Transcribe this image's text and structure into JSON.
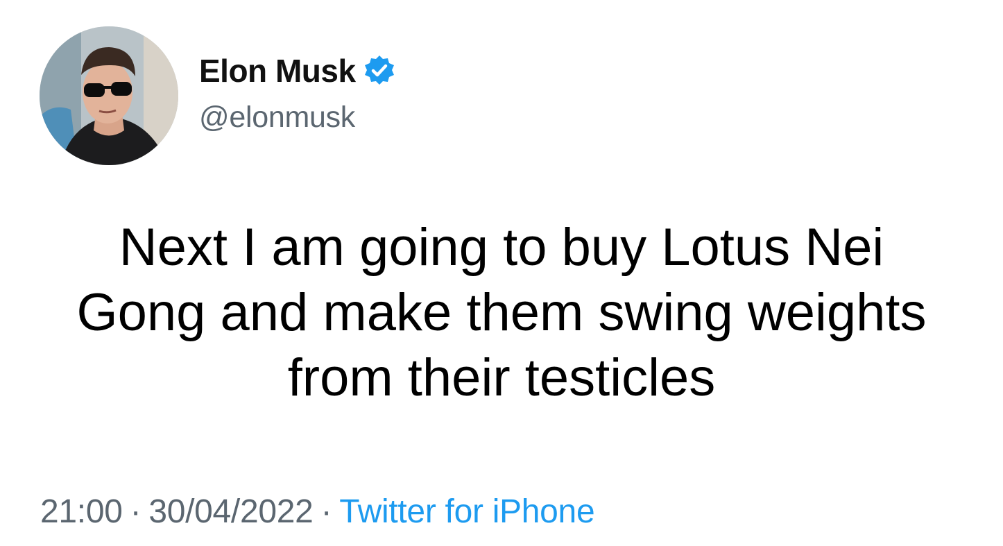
{
  "author": {
    "display_name": "Elon Musk",
    "handle": "@elonmusk",
    "verified": true
  },
  "tweet": {
    "lines": [
      "Next I am going to buy Lotus Nei",
      "Gong and make them swing weights",
      "from their testicles"
    ]
  },
  "meta": {
    "time": "21:00",
    "separator": "·",
    "date": "30/04/2022",
    "source": "Twitter for iPhone"
  },
  "icons": {
    "verified": "verified-badge-icon",
    "avatar": "profile-photo"
  },
  "colors": {
    "background": "#ffffff",
    "text": "#000000",
    "secondary_text": "#5b6670",
    "accent": "#1d9bf0"
  }
}
